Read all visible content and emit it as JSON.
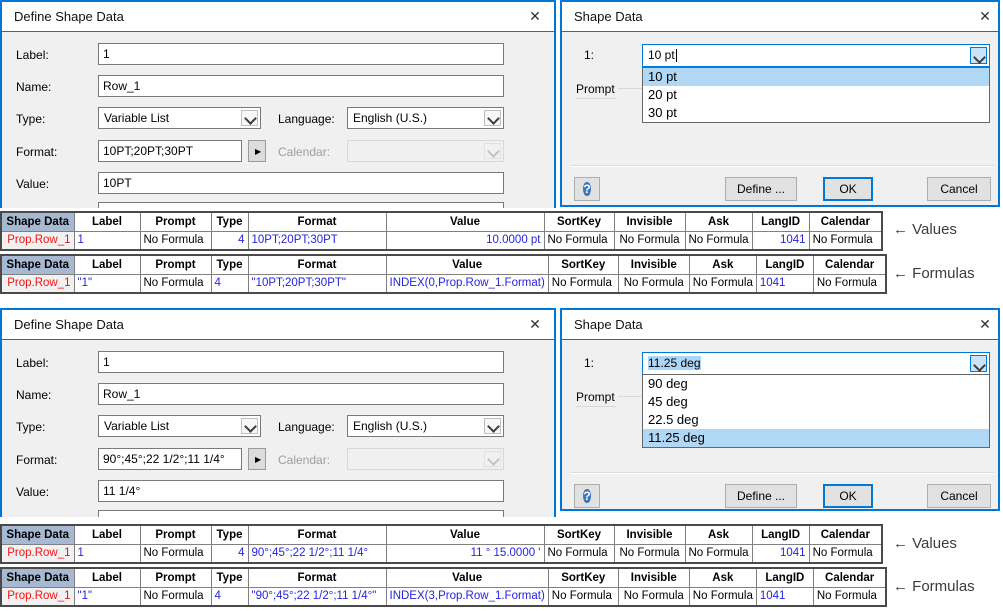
{
  "icons": {
    "close": "✕",
    "help": "?",
    "expand": "▶"
  },
  "annotations": {
    "values_label": "← Values",
    "formulas_label": "← Formulas"
  },
  "dialogs": {
    "define_top": {
      "title": "Define Shape Data",
      "label_caption": "Label:",
      "label_value": "1",
      "name_caption": "Name:",
      "name_value": "Row_1",
      "type_caption": "Type:",
      "type_value": "Variable List",
      "language_caption": "Language:",
      "language_value": "English (U.S.)",
      "format_caption": "Format:",
      "format_value": "10PT;20PT;30PT",
      "calendar_caption": "Calendar:",
      "calendar_value": "",
      "value_caption": "Value:",
      "value_value": "10PT"
    },
    "shape_top": {
      "title": "Shape Data",
      "row_caption": "1:",
      "combo_value": "10 pt",
      "items": [
        "10 pt",
        "20 pt",
        "30 pt"
      ],
      "selected_index": 0,
      "prompt_caption": "Prompt",
      "define_label": "Define ...",
      "ok_label": "OK",
      "cancel_label": "Cancel"
    },
    "define_bottom": {
      "title": "Define Shape Data",
      "label_caption": "Label:",
      "label_value": "1",
      "name_caption": "Name:",
      "name_value": "Row_1",
      "type_caption": "Type:",
      "type_value": "Variable List",
      "language_caption": "Language:",
      "language_value": "English (U.S.)",
      "format_caption": "Format:",
      "format_value": "90°;45°;22 1/2°;11 1/4°",
      "calendar_caption": "Calendar:",
      "calendar_value": "",
      "value_caption": "Value:",
      "value_value": "11 1/4°"
    },
    "shape_bottom": {
      "title": "Shape Data",
      "row_caption": "1:",
      "combo_value": "11.25 deg",
      "items": [
        "90 deg",
        "45 deg",
        "22.5 deg",
        "11.25 deg"
      ],
      "selected_index": 3,
      "prompt_caption": "Prompt",
      "define_label": "Define ...",
      "ok_label": "OK",
      "cancel_label": "Cancel"
    }
  },
  "table": {
    "headers": [
      "Shape Data",
      "Label",
      "Prompt",
      "Type",
      "Format",
      "Value",
      "SortKey",
      "Invisible",
      "Ask",
      "LangID",
      "Calendar"
    ]
  },
  "rows": {
    "values_top": [
      "Prop.Row_1",
      "1",
      "No Formula",
      "4",
      "10PT;20PT;30PT",
      "10.0000 pt",
      "No Formula",
      "No Formula",
      "No Formula",
      "1041",
      "No Formula"
    ],
    "formulas_top": [
      "Prop.Row_1",
      "\"1\"",
      "No Formula",
      "4",
      "\"10PT;20PT;30PT\"",
      "INDEX(0,Prop.Row_1.Format)",
      "No Formula",
      "No Formula",
      "No Formula",
      "1041",
      "No Formula"
    ],
    "values_bottom": [
      "Prop.Row_1",
      "1",
      "No Formula",
      "4",
      "90°;45°;22 1/2°;11 1/4°",
      "11 ° 15.0000 '",
      "No Formula",
      "No Formula",
      "No Formula",
      "1041",
      "No Formula"
    ],
    "formulas_bottom": [
      "Prop.Row_1",
      "\"1\"",
      "No Formula",
      "4",
      "\"90°;45°;22 1/2°;11 1/4°\"",
      "INDEX(3,Prop.Row_1.Format)",
      "No Formula",
      "No Formula",
      "No Formula",
      "1041",
      "No Formula"
    ]
  }
}
